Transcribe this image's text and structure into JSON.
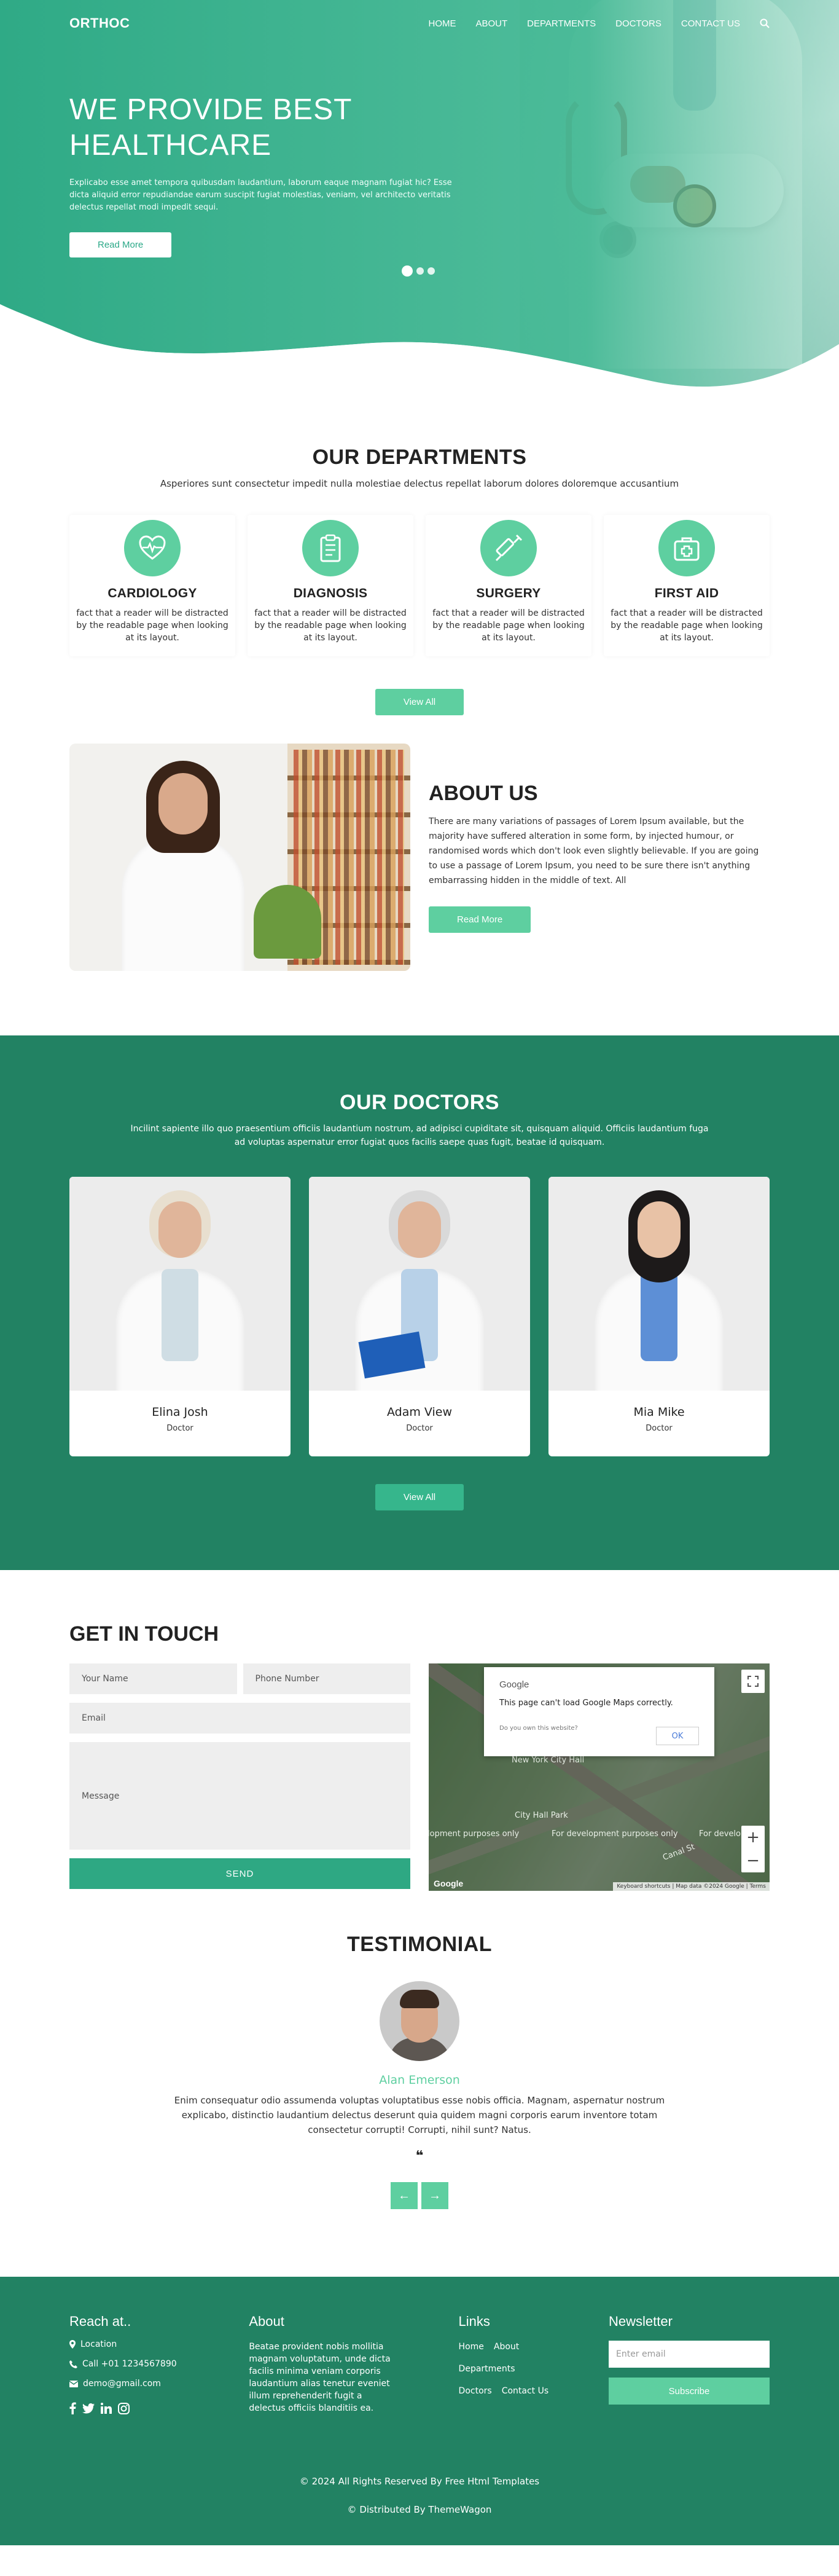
{
  "brand": {
    "logo": "ORTHOC",
    "accent": "#5ecfa0",
    "dark_green": "#228263"
  },
  "nav": {
    "items": [
      "HOME",
      "ABOUT",
      "DEPARTMENTS",
      "DOCTORS",
      "CONTACT US"
    ],
    "search_icon": "search-icon"
  },
  "hero": {
    "title_line1": "WE PROVIDE BEST",
    "title_line2": "HEALTHCARE",
    "text": "Explicabo esse amet tempora quibusdam laudantium, laborum eaque magnam fugiat hic? Esse dicta aliquid error repudiandae earum suscipit fugiat molestias, veniam, vel architecto veritatis delectus repellat modi impedit sequi.",
    "button": "Read More"
  },
  "departments": {
    "title": "OUR DEPARTMENTS",
    "subtitle": "Asperiores sunt consectetur impedit nulla molestiae delectus repellat laborum dolores doloremque accusantium",
    "items": [
      {
        "name": "CARDIOLOGY",
        "text": "fact that a reader will be distracted by the readable page when looking at its layout.",
        "icon": "heart-icon"
      },
      {
        "name": "DIAGNOSIS",
        "text": "fact that a reader will be distracted by the readable page when looking at its layout.",
        "icon": "clipboard-icon"
      },
      {
        "name": "SURGERY",
        "text": "fact that a reader will be distracted by the readable page when looking at its layout.",
        "icon": "syringe-icon"
      },
      {
        "name": "FIRST AID",
        "text": "fact that a reader will be distracted by the readable page when looking at its layout.",
        "icon": "first-aid-icon"
      }
    ],
    "button": "View All"
  },
  "about": {
    "title": "ABOUT US",
    "text": "There are many variations of passages of Lorem Ipsum available, but the majority have suffered alteration in some form, by injected humour, or randomised words which don't look even slightly believable. If you are going to use a passage of Lorem Ipsum, you need to be sure there isn't anything embarrassing hidden in the middle of text. All",
    "button": "Read More"
  },
  "doctors": {
    "title": "OUR DOCTORS",
    "subtitle": "Incilint sapiente illo quo praesentium officiis laudantium nostrum, ad adipisci cupiditate sit, quisquam aliquid. Officiis laudantium fuga ad voluptas aspernatur error fugiat quos facilis saepe quas fugit, beatae id quisquam.",
    "items": [
      {
        "name": "Elina Josh",
        "role": "Doctor"
      },
      {
        "name": "Adam View",
        "role": "Doctor"
      },
      {
        "name": "Mia Mike",
        "role": "Doctor"
      }
    ],
    "button": "View All"
  },
  "contact": {
    "title": "GET IN TOUCH",
    "name_placeholder": "Your Name",
    "phone_placeholder": "Phone Number",
    "email_placeholder": "Email",
    "message_placeholder": "Message",
    "button": "SEND",
    "map": {
      "brand": "Google",
      "error": "This page can't load Google Maps correctly.",
      "own": "Do you own this website?",
      "ok": "OK",
      "zoom_in": "+",
      "zoom_out": "−",
      "logo": "Google",
      "footer": "Keyboard shortcuts | Map data ©2024 Google | Terms",
      "labels": [
        "New York City Hall",
        "lopment purposes only",
        "For development purposes only",
        "For develop",
        "City Hall Park",
        "Canal St"
      ]
    }
  },
  "testimonial": {
    "title": "TESTIMONIAL",
    "name": "Alan Emerson",
    "text": "Enim consequatur odio assumenda voluptas voluptatibus esse nobis officia. Magnam, aspernatur nostrum explicabo, distinctio laudantium delectus deserunt quia quidem magni corporis earum inventore totam consectetur corrupti! Corrupti, nihil sunt? Natus.",
    "quote": "❝",
    "prev": "←",
    "next": "→"
  },
  "footer": {
    "reach_title": "Reach at..",
    "location": "Location",
    "phone": "Call +01 1234567890",
    "email": "demo@gmail.com",
    "about_title": "About",
    "about_text": "Beatae provident nobis mollitia magnam voluptatum, unde dicta facilis minima veniam corporis laudantium alias tenetur eveniet illum reprehenderit fugit a delectus officiis blanditiis ea.",
    "links_title": "Links",
    "links": [
      "Home",
      "About",
      "Departments",
      "Doctors",
      "Contact Us"
    ],
    "newsletter_title": "Newsletter",
    "newsletter_placeholder": "Enter email",
    "subscribe": "Subscribe",
    "copyright": "© 2024 All Rights Reserved By Free Html Templates",
    "distributed": "© Distributed By ThemeWagon"
  }
}
